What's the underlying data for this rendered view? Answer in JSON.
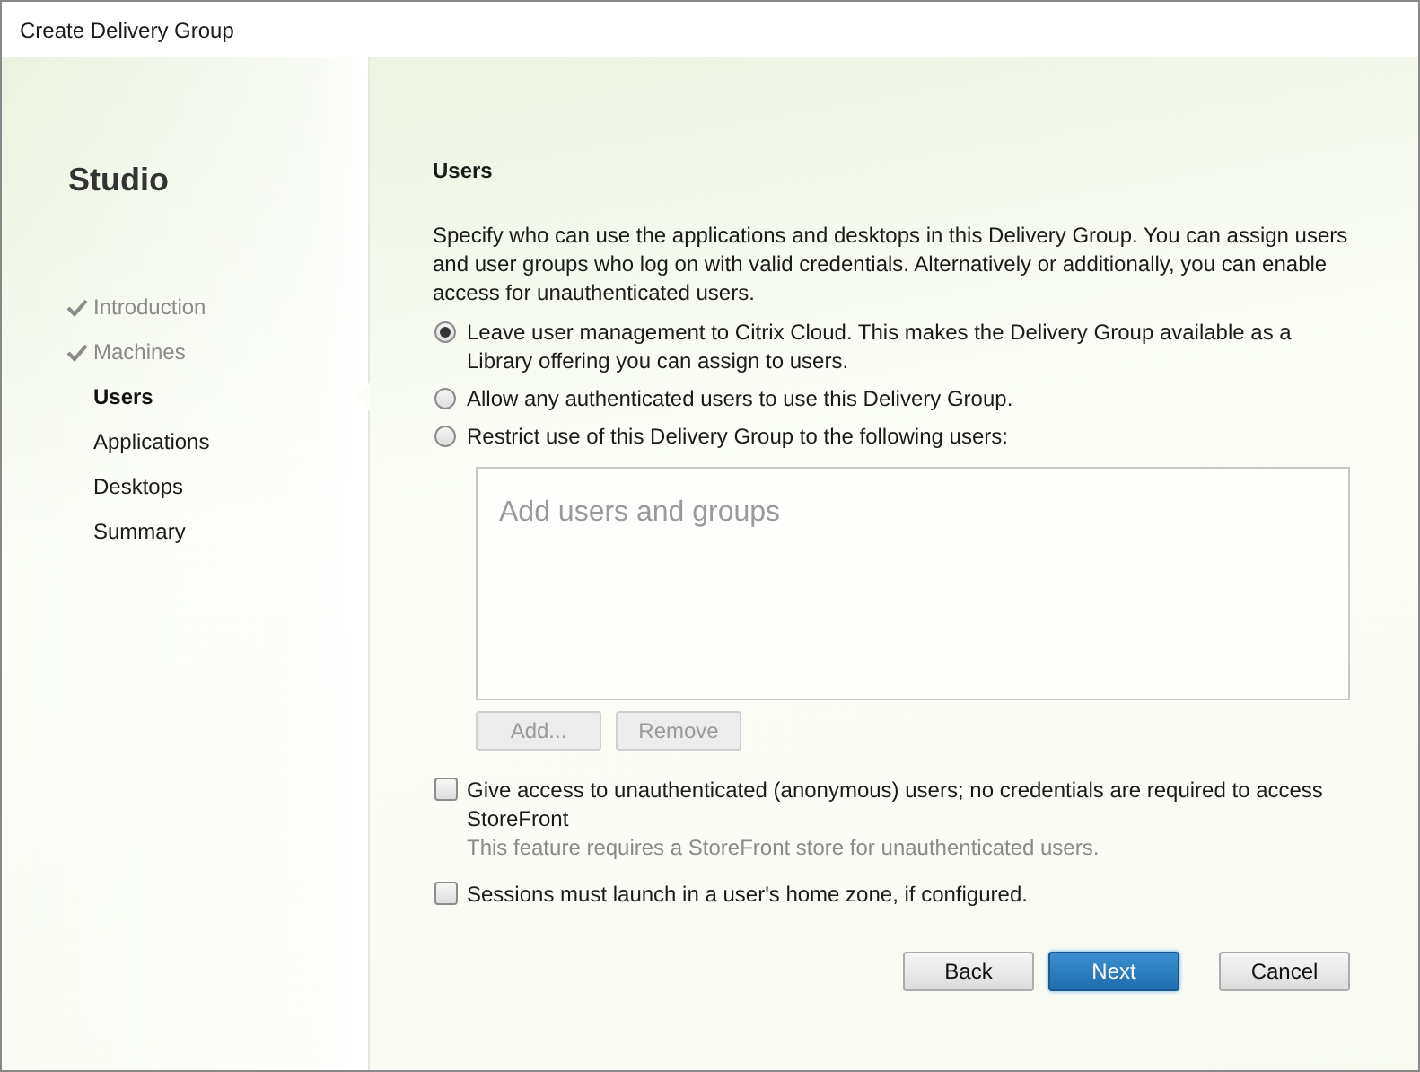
{
  "window": {
    "title": "Create Delivery Group"
  },
  "sidebar": {
    "title": "Studio",
    "items": [
      {
        "label": "Introduction",
        "completed": true,
        "selected": false
      },
      {
        "label": "Machines",
        "completed": true,
        "selected": false
      },
      {
        "label": "Users",
        "completed": false,
        "selected": true
      },
      {
        "label": "Applications",
        "completed": false,
        "selected": false
      },
      {
        "label": "Desktops",
        "completed": false,
        "selected": false
      },
      {
        "label": "Summary",
        "completed": false,
        "selected": false
      }
    ]
  },
  "page": {
    "heading": "Users",
    "description": "Specify who can use the applications and desktops in this Delivery Group. You can assign users and user groups who log on with valid credentials. Alternatively or additionally, you can enable access for unauthenticated users.",
    "options": [
      {
        "label": "Leave user management to Citrix Cloud. This makes the Delivery Group available as a Library offering you can assign to users.",
        "selected": true
      },
      {
        "label": "Allow any authenticated users to use this Delivery Group.",
        "selected": false
      },
      {
        "label": "Restrict use of this Delivery Group to the following users:",
        "selected": false
      }
    ],
    "users_list": {
      "placeholder": "Add users and groups"
    },
    "list_buttons": [
      {
        "label": "Add...",
        "disabled": true
      },
      {
        "label": "Remove",
        "disabled": true
      }
    ],
    "checkboxes": [
      {
        "label": "Give access to unauthenticated (anonymous) users; no credentials are required to access StoreFront",
        "checked": false,
        "note": "This feature requires a StoreFront store for unauthenticated users."
      },
      {
        "label": "Sessions must launch in a user's home zone, if configured.",
        "checked": false
      }
    ]
  },
  "buttons": [
    {
      "label": "Back",
      "default": false
    },
    {
      "label": "Next",
      "default": true
    },
    {
      "label": "Cancel",
      "default": false
    }
  ]
}
